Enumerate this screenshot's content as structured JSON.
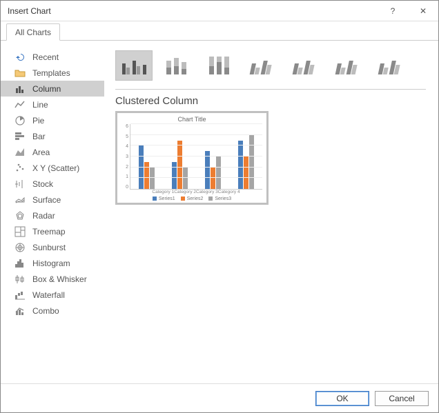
{
  "titlebar": {
    "title": "Insert Chart",
    "help": "?",
    "close": "✕"
  },
  "tabs": [
    {
      "label": "All Charts"
    }
  ],
  "sidebar": {
    "items": [
      {
        "label": "Recent",
        "icon": "undo-icon"
      },
      {
        "label": "Templates",
        "icon": "folder-icon"
      },
      {
        "label": "Column",
        "icon": "column-icon",
        "selected": true
      },
      {
        "label": "Line",
        "icon": "line-icon"
      },
      {
        "label": "Pie",
        "icon": "pie-icon"
      },
      {
        "label": "Bar",
        "icon": "bar-icon"
      },
      {
        "label": "Area",
        "icon": "area-icon"
      },
      {
        "label": "X Y (Scatter)",
        "icon": "scatter-icon"
      },
      {
        "label": "Stock",
        "icon": "stock-icon"
      },
      {
        "label": "Surface",
        "icon": "surface-icon"
      },
      {
        "label": "Radar",
        "icon": "radar-icon"
      },
      {
        "label": "Treemap",
        "icon": "treemap-icon"
      },
      {
        "label": "Sunburst",
        "icon": "sunburst-icon"
      },
      {
        "label": "Histogram",
        "icon": "histogram-icon"
      },
      {
        "label": "Box & Whisker",
        "icon": "boxwhisker-icon"
      },
      {
        "label": "Waterfall",
        "icon": "waterfall-icon"
      },
      {
        "label": "Combo",
        "icon": "combo-icon"
      }
    ]
  },
  "subtype": {
    "selected_label": "Clustered Column",
    "items": [
      {
        "name": "clustered-column",
        "selected": true
      },
      {
        "name": "stacked-column"
      },
      {
        "name": "100-stacked-column"
      },
      {
        "name": "3d-clustered-column"
      },
      {
        "name": "3d-stacked-column"
      },
      {
        "name": "3d-100-stacked-column"
      },
      {
        "name": "3d-column"
      }
    ]
  },
  "preview": {
    "title": "Chart Title"
  },
  "chart_data": {
    "type": "bar",
    "title": "Chart Title",
    "categories": [
      "Category 1",
      "Category 2",
      "Category 3",
      "Category 4"
    ],
    "series": [
      {
        "name": "Series1",
        "color": "#4a7ebb",
        "values": [
          4.0,
          2.5,
          3.5,
          4.5
        ]
      },
      {
        "name": "Series2",
        "color": "#ed7d31",
        "values": [
          2.5,
          4.5,
          2.0,
          3.0
        ]
      },
      {
        "name": "Series3",
        "color": "#a5a5a5",
        "values": [
          2.0,
          2.0,
          3.0,
          5.0
        ]
      }
    ],
    "ylim": [
      0,
      6
    ],
    "yticks": [
      0,
      1,
      2,
      3,
      4,
      5,
      6
    ],
    "xlabel": "",
    "ylabel": ""
  },
  "footer": {
    "ok": "OK",
    "cancel": "Cancel"
  }
}
